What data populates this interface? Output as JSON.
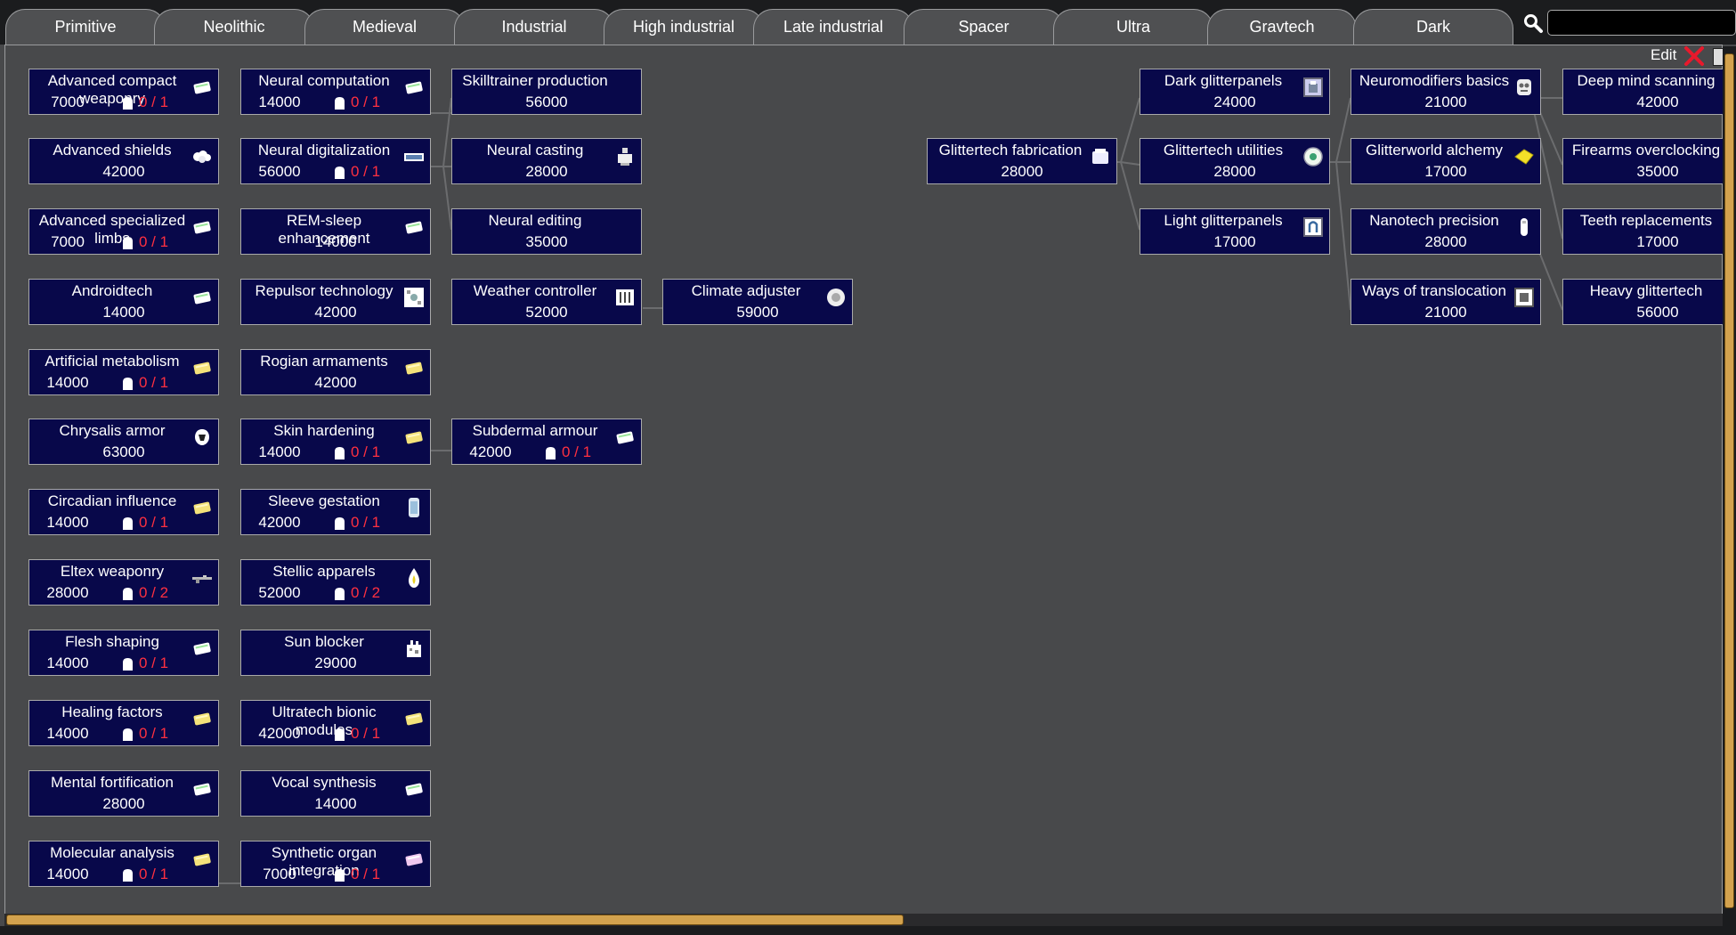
{
  "tabs": [
    "Primitive",
    "Neolithic",
    "Medieval",
    "Industrial",
    "High industrial",
    "Late industrial",
    "Spacer",
    "Ultra",
    "Gravtech",
    "Dark"
  ],
  "search": {
    "value": "",
    "placeholder": ""
  },
  "toolbar": {
    "edit_label": "Edit"
  },
  "colors": {
    "node_bg": "#08084a",
    "requirement_text": "#ff3040",
    "scrollbar_thumb": "#d3a24e"
  },
  "projects": [
    {
      "label": "Advanced compact weaponry",
      "cost": "7000",
      "req": "0 / 1",
      "icon": "tablet-icon"
    },
    {
      "label": "Advanced shields",
      "cost": "42000",
      "icon": "shield-cells-icon"
    },
    {
      "label": "Advanced specialized limbs",
      "cost": "7000",
      "req": "0 / 1",
      "icon": "tablet-icon"
    },
    {
      "label": "Androidtech",
      "cost": "14000",
      "icon": "tablet-icon"
    },
    {
      "label": "Artificial metabolism",
      "cost": "14000",
      "req": "0 / 1",
      "icon": "gold-tablet-icon"
    },
    {
      "label": "Chrysalis armor",
      "cost": "63000",
      "icon": "armor-icon"
    },
    {
      "label": "Circadian influence",
      "cost": "14000",
      "req": "0 / 1",
      "icon": "gold-tablet-icon"
    },
    {
      "label": "Eltex weaponry",
      "cost": "28000",
      "req": "0 / 2",
      "icon": "rifle-icon"
    },
    {
      "label": "Flesh shaping",
      "cost": "14000",
      "req": "0 / 1",
      "icon": "tablet-icon"
    },
    {
      "label": "Healing factors",
      "cost": "14000",
      "req": "0 / 1",
      "icon": "gold-tablet-icon"
    },
    {
      "label": "Mental fortification",
      "cost": "28000",
      "icon": "tablet-icon"
    },
    {
      "label": "Molecular analysis",
      "cost": "14000",
      "req": "0 / 1",
      "icon": "gold-tablet-icon"
    },
    {
      "label": "Neural computation",
      "cost": "14000",
      "req": "0 / 1",
      "icon": "tablet-icon"
    },
    {
      "label": "Neural digitalization",
      "cost": "56000",
      "req": "0 / 1",
      "icon": "chip-icon"
    },
    {
      "label": "REM-sleep enhancement",
      "cost": "14000",
      "icon": "tablet-icon"
    },
    {
      "label": "Repulsor technology",
      "cost": "42000",
      "icon": "repulsor-icon"
    },
    {
      "label": "Rogian armaments",
      "cost": "42000",
      "icon": "gold-tablet-icon"
    },
    {
      "label": "Skin hardening",
      "cost": "14000",
      "req": "0 / 1",
      "icon": "gold-tablet-icon"
    },
    {
      "label": "Sleeve gestation",
      "cost": "42000",
      "req": "0 / 1",
      "icon": "vat-icon"
    },
    {
      "label": "Stellic apparels",
      "cost": "52000",
      "req": "0 / 2",
      "icon": "flame-icon"
    },
    {
      "label": "Sun blocker",
      "cost": "29000",
      "icon": "sun-blocker-icon"
    },
    {
      "label": "Ultratech bionic modules",
      "cost": "42000",
      "req": "0 / 1",
      "icon": "gold-tablet-icon"
    },
    {
      "label": "Vocal synthesis",
      "cost": "14000",
      "icon": "tablet-icon"
    },
    {
      "label": "Synthetic organ integration",
      "cost": "7000",
      "req": "0 / 1",
      "icon": "pink-tablet-icon"
    },
    {
      "label": "Skilltrainer production",
      "cost": "56000",
      "icon": ""
    },
    {
      "label": "Neural casting",
      "cost": "28000",
      "icon": "neural-cast-icon"
    },
    {
      "label": "Neural editing",
      "cost": "35000",
      "icon": ""
    },
    {
      "label": "Weather controller",
      "cost": "52000",
      "icon": "weather-icon"
    },
    {
      "label": "Subdermal armour",
      "cost": "42000",
      "req": "0 / 1",
      "icon": "tablet-icon"
    },
    {
      "label": "Climate adjuster",
      "cost": "59000",
      "icon": "climate-icon"
    },
    {
      "label": "Glittertech fabrication",
      "cost": "28000",
      "icon": "bench-icon"
    },
    {
      "label": "Dark glitterpanels",
      "cost": "24000",
      "icon": "panel-icon"
    },
    {
      "label": "Glittertech utilities",
      "cost": "28000",
      "icon": "sphere-icon"
    },
    {
      "label": "Light glitterpanels",
      "cost": "17000",
      "icon": "light-panel-icon"
    },
    {
      "label": "Neuromodifiers basics",
      "cost": "21000",
      "icon": "neuromod-icon"
    },
    {
      "label": "Glitterworld alchemy",
      "cost": "17000",
      "icon": "yellow-gem-icon"
    },
    {
      "label": "Nanotech precision",
      "cost": "28000",
      "icon": "vial-icon"
    },
    {
      "label": "Ways of translocation",
      "cost": "21000",
      "icon": "portal-icon"
    },
    {
      "label": "Deep mind scanning",
      "cost": "42000",
      "icon": ""
    },
    {
      "label": "Firearms overclocking",
      "cost": "35000",
      "icon": ""
    },
    {
      "label": "Teeth replacements",
      "cost": "17000",
      "icon": ""
    },
    {
      "label": "Heavy glittertech",
      "cost": "56000",
      "icon": ""
    }
  ]
}
